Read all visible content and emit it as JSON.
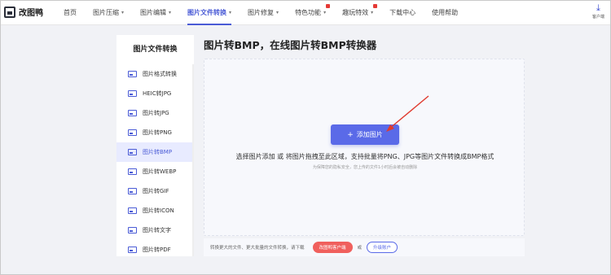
{
  "app": {
    "logo_text": "改图鸭"
  },
  "nav": {
    "items": [
      {
        "label": "首页",
        "dropdown": false,
        "active": false,
        "hot": false
      },
      {
        "label": "图片压缩",
        "dropdown": true,
        "active": false,
        "hot": false
      },
      {
        "label": "图片编辑",
        "dropdown": true,
        "active": false,
        "hot": false
      },
      {
        "label": "图片文件转换",
        "dropdown": true,
        "active": true,
        "hot": false
      },
      {
        "label": "图片修复",
        "dropdown": true,
        "active": false,
        "hot": false
      },
      {
        "label": "特色功能",
        "dropdown": true,
        "active": false,
        "hot": true
      },
      {
        "label": "趣玩特效",
        "dropdown": true,
        "active": false,
        "hot": true
      },
      {
        "label": "下载中心",
        "dropdown": false,
        "active": false,
        "hot": false
      },
      {
        "label": "使用帮助",
        "dropdown": false,
        "active": false,
        "hot": false
      }
    ],
    "client_label": "客户端"
  },
  "sidebar": {
    "title": "图片文件转换",
    "items": [
      {
        "label": "图片格式转换",
        "active": false
      },
      {
        "label": "HEIC转JPG",
        "active": false
      },
      {
        "label": "图片转JPG",
        "active": false
      },
      {
        "label": "图片转PNG",
        "active": false
      },
      {
        "label": "图片转BMP",
        "active": true
      },
      {
        "label": "图片转WEBP",
        "active": false
      },
      {
        "label": "图片转GIF",
        "active": false
      },
      {
        "label": "图片转ICON",
        "active": false
      },
      {
        "label": "图片转文字",
        "active": false
      },
      {
        "label": "图片转PDF",
        "active": false
      }
    ]
  },
  "main": {
    "title": "图片转BMP，在线图片转BMP转换器",
    "add_button": "添加图片",
    "hint": "选择图片添加 或 将图片拖拽至此区域，支持批量将PNG、JPG等图片文件转换成BMP格式",
    "sub_hint": "为保障您的隐私安全，您上传的文件1小时后会被自动删除"
  },
  "footer": {
    "text": "转换更大的文件、更大批量的文件转换，请下载",
    "client_button": "改图鸭客户端",
    "or": "或",
    "upgrade_button": "升级账户"
  },
  "colors": {
    "accent": "#4a5bd6",
    "button": "#5a6ae8",
    "alert": "#f0605d",
    "arrow": "#e03a2f"
  }
}
